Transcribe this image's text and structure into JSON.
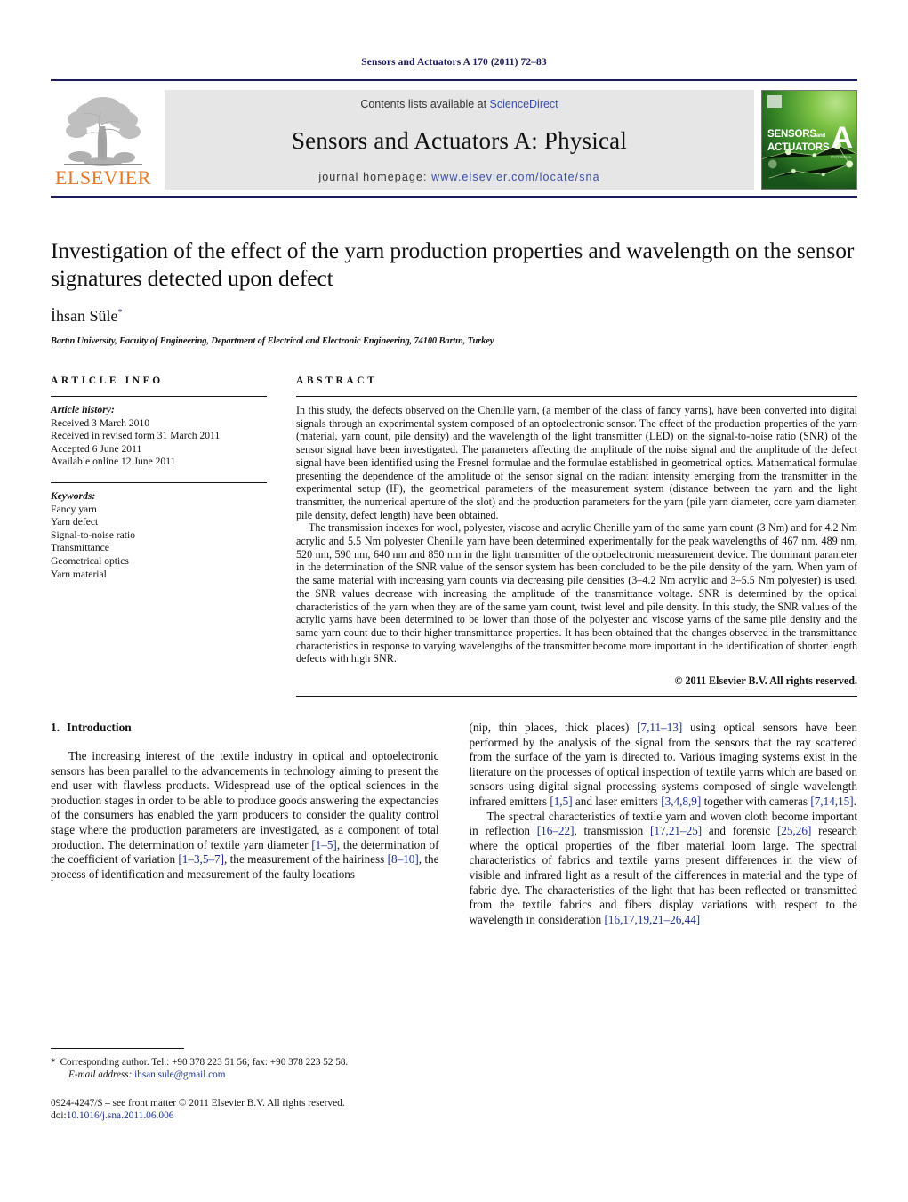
{
  "running_head": "Sensors and Actuators A 170 (2011) 72–83",
  "masthead": {
    "publisher_name": "ELSEVIER",
    "contents_prefix": "Contents lists available at ",
    "sciencedirect_label": "ScienceDirect",
    "journal_title": "Sensors and Actuators A: Physical",
    "homepage_prefix": "journal homepage: ",
    "homepage_url": "www.elsevier.com/locate/sna",
    "cover": {
      "line1": "SENSORS",
      "line1_suffix": "and",
      "line2": "ACTUATORS",
      "letter": "A",
      "sub_letter": "PHYSICAL"
    }
  },
  "article": {
    "title": "Investigation of the effect of the yarn production properties and wavelength on the sensor signatures detected upon defect",
    "author": "İhsan Süle",
    "author_marker": "*",
    "affiliation": "Bartın University, Faculty of Engineering, Department of Electrical and Electronic Engineering, 74100 Bartın, Turkey"
  },
  "article_info": {
    "heading": "ARTICLE INFO",
    "history_label": "Article history:",
    "history": [
      "Received 3 March 2010",
      "Received in revised form 31 March 2011",
      "Accepted 6 June 2011",
      "Available online 12 June 2011"
    ],
    "keywords_label": "Keywords:",
    "keywords": [
      "Fancy yarn",
      "Yarn defect",
      "Signal-to-noise ratio",
      "Transmittance",
      "Geometrical optics",
      "Yarn material"
    ]
  },
  "abstract": {
    "heading": "ABSTRACT",
    "paragraph1": "In this study, the defects observed on the Chenille yarn, (a member of the class of fancy yarns), have been converted into digital signals through an experimental system composed of an optoelectronic sensor. The effect of the production properties of the yarn (material, yarn count, pile density) and the wavelength of the light transmitter (LED) on the signal-to-noise ratio (SNR) of the sensor signal have been investigated. The parameters affecting the amplitude of the noise signal and the amplitude of the defect signal have been identified using the Fresnel formulae and the formulae established in geometrical optics. Mathematical formulae presenting the dependence of the amplitude of the sensor signal on the radiant intensity emerging from the transmitter in the experimental setup (IF), the geometrical parameters of the measurement system (distance between the yarn and the light transmitter, the numerical aperture of the slot) and the production parameters for the yarn (pile yarn diameter, core yarn diameter, pile density, defect length) have been obtained.",
    "paragraph2": "The transmission indexes for wool, polyester, viscose and acrylic Chenille yarn of the same yarn count (3 Nm) and for 4.2 Nm acrylic and 5.5 Nm polyester Chenille yarn have been determined experimentally for the peak wavelengths of 467 nm, 489 nm, 520 nm, 590 nm, 640 nm and 850 nm in the light transmitter of the optoelectronic measurement device. The dominant parameter in the determination of the SNR value of the sensor system has been concluded to be the pile density of the yarn. When yarn of the same material with increasing yarn counts via decreasing pile densities (3–4.2 Nm acrylic and 3–5.5 Nm polyester) is used, the SNR values decrease with increasing the amplitude of the transmittance voltage. SNR is determined by the optical characteristics of the yarn when they are of the same yarn count, twist level and pile density. In this study, the SNR values of the acrylic yarns have been determined to be lower than those of the polyester and viscose yarns of the same pile density and the same yarn count due to their higher transmittance properties. It has been obtained that the changes observed in the transmittance characteristics in response to varying wavelengths of the transmitter become more important in the identification of shorter length defects with high SNR.",
    "copyright": "© 2011 Elsevier B.V. All rights reserved."
  },
  "introduction": {
    "number": "1.",
    "title": "Introduction",
    "left_paragraph_part1": "The increasing interest of the textile industry in optical and optoelectronic sensors has been parallel to the advancements in technology aiming to present the end user with flawless products. Widespread use of the optical sciences in the production stages in order to be able to produce goods answering the expectancies of the consumers has enabled the yarn producers to consider the quality control stage where the production parameters are investigated, as a component of total production. The determination of textile yarn diameter ",
    "ref_1_5": "[1–5]",
    "mid_1": ", the determination of the coefficient of variation ",
    "ref_1_3_5_7": "[1–3,5–7]",
    "mid_2": ", the measurement of the hairiness ",
    "ref_8_10": "[8–10]",
    "mid_3": ", the process of identification and measurement of the faulty locations ",
    "right_continue_1": "(nip, thin places, thick places) ",
    "ref_7_11_13": "[7,11–13]",
    "right_continue_2": " using optical sensors have been performed by the analysis of the signal from the sensors that the ray scattered from the surface of the yarn is directed to. Various imaging systems exist in the literature on the processes of optical inspection of textile yarns which are based on sensors using digital signal processing systems composed of single wavelength infrared emitters ",
    "ref_1_5b": "[1,5]",
    "right_continue_3": " and laser emitters ",
    "ref_3_4_8_9": "[3,4,8,9]",
    "right_continue_4": " together with cameras ",
    "ref_7_14_15": "[7,14,15]",
    "right_continue_5": ".",
    "p2_part1": "The spectral characteristics of textile yarn and woven cloth become important in reflection ",
    "ref_16_22": "[16–22]",
    "p2_part2": ", transmission ",
    "ref_17_21_25": "[17,21–25]",
    "p2_part3": " and forensic ",
    "ref_25_26": "[25,26]",
    "p2_part4": " research where the optical properties of the fiber material loom large. The spectral characteristics of fabrics and textile yarns present differences in the view of visible and infrared light as a result of the differences in material and the type of fabric dye. The characteristics of the light that has been reflected or transmitted from the textile fabrics and fibers display variations with respect to the wavelength in consideration ",
    "ref_16_17_19": "[16,17,19,21–26,44]"
  },
  "footnotes": {
    "corresponding_marker": "*",
    "corresponding_text": "Corresponding author. Tel.: +90 378 223 51 56; fax: +90 378 223 52 58.",
    "email_label": "E-mail address:",
    "email": "ihsan.sule@gmail.com",
    "issn_line": "0924-4247/$ – see front matter © 2011 Elsevier B.V. All rights reserved.",
    "doi_label": "doi:",
    "doi_value": "10.1016/j.sna.2011.06.006"
  },
  "colors": {
    "rule_blue": "#1a1a5e",
    "link_blue": "#1a2f8f",
    "elsevier_orange": "#E87722",
    "band_gray": "#e6e6e6"
  }
}
